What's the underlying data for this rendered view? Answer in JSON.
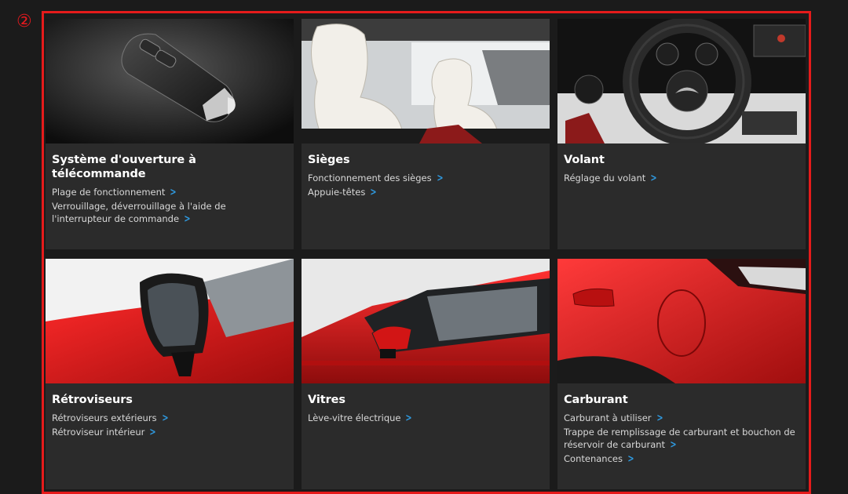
{
  "marker": "②",
  "cards": [
    {
      "title": "Système d'ouverture à télécommande",
      "links": [
        "Plage de fonctionnement",
        "Verrouillage, déverrouillage à l'aide de l'interrupteur de commande"
      ]
    },
    {
      "title": "Sièges",
      "links": [
        "Fonctionnement des sièges",
        "Appuie-têtes"
      ]
    },
    {
      "title": "Volant",
      "links": [
        "Réglage du volant"
      ]
    },
    {
      "title": "Rétroviseurs",
      "links": [
        "Rétroviseurs extérieurs",
        "Rétroviseur intérieur"
      ]
    },
    {
      "title": "Vitres",
      "links": [
        "Lève-vitre électrique"
      ]
    },
    {
      "title": "Carburant",
      "links": [
        "Carburant à utiliser",
        "Trappe de remplissage de carburant et bouchon de réservoir de carburant",
        "Contenances"
      ]
    }
  ],
  "colors": {
    "accent_frame": "#e51b1b",
    "chevron": "#2f9ae0",
    "card_bg": "#2b2b2b",
    "page_bg": "#1b1b1b"
  },
  "icons": {
    "link_chevron": "chevron-right-icon"
  }
}
